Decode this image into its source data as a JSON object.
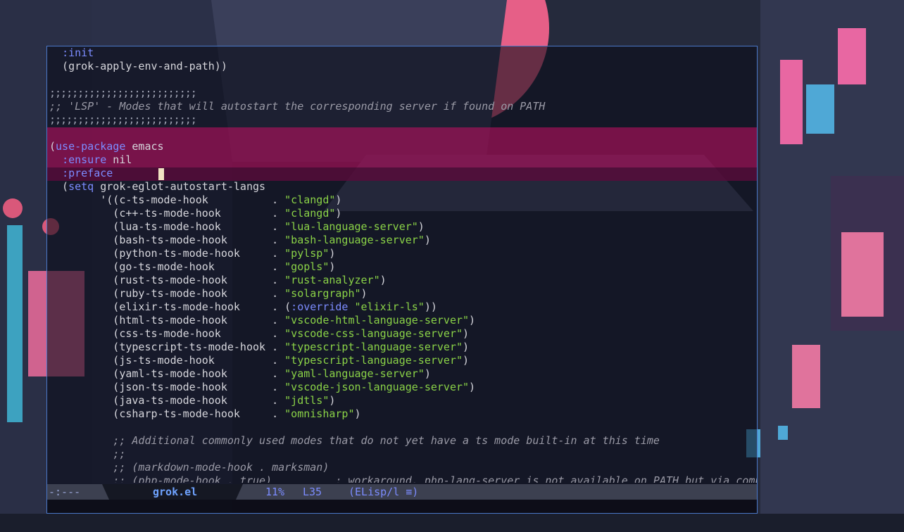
{
  "editor": {
    "lines": [
      [
        {
          "t": "  "
        },
        {
          "t": ":init",
          "c": "kw"
        }
      ],
      [
        {
          "t": "  (grok-apply-env-and-path))"
        }
      ],
      [
        {
          "t": ""
        }
      ],
      [
        {
          "t": ";;;;;;;;;;;;;;;;;;;;;;;;;;",
          "c": "cml"
        }
      ],
      [
        {
          "t": ";; ",
          "c": "cm"
        },
        {
          "t": "'LSP'",
          "c": "cm"
        },
        {
          "t": " - Modes that will autostart the corresponding server if found on PATH",
          "c": "cm"
        }
      ],
      [
        {
          "t": ";;;;;;;;;;;;;;;;;;;;;;;;;;",
          "c": "cml"
        }
      ],
      [
        {
          "t": ""
        }
      ],
      [
        {
          "t": "("
        },
        {
          "t": "use-package",
          "c": "kw"
        },
        {
          "t": " emacs"
        }
      ],
      [
        {
          "t": "  "
        },
        {
          "t": ":ensure",
          "c": "kw"
        },
        {
          "t": " nil"
        }
      ],
      [
        {
          "t": "  "
        },
        {
          "t": ":preface",
          "c": "kw"
        }
      ],
      [
        {
          "t": "  ("
        },
        {
          "t": "setq",
          "c": "kw"
        },
        {
          "t": " grok-eglot-autostart-langs"
        }
      ],
      [
        {
          "t": "        '((c-ts-mode-hook          . "
        },
        {
          "t": "\"clangd\"",
          "c": "str"
        },
        {
          "t": ")"
        }
      ],
      [
        {
          "t": "          (c++-ts-mode-hook        . "
        },
        {
          "t": "\"clangd\"",
          "c": "str"
        },
        {
          "t": ")"
        }
      ],
      [
        {
          "t": "          (lua-ts-mode-hook        . "
        },
        {
          "t": "\"lua-language-server\"",
          "c": "str"
        },
        {
          "t": ")"
        }
      ],
      [
        {
          "t": "          (bash-ts-mode-hook       . "
        },
        {
          "t": "\"bash-language-server\"",
          "c": "str"
        },
        {
          "t": ")"
        }
      ],
      [
        {
          "t": "          (python-ts-mode-hook     . "
        },
        {
          "t": "\"pylsp\"",
          "c": "str"
        },
        {
          "t": ")"
        }
      ],
      [
        {
          "t": "          (go-ts-mode-hook         . "
        },
        {
          "t": "\"gopls\"",
          "c": "str"
        },
        {
          "t": ")"
        }
      ],
      [
        {
          "t": "          (rust-ts-mode-hook       . "
        },
        {
          "t": "\"rust-analyzer\"",
          "c": "str"
        },
        {
          "t": ")"
        }
      ],
      [
        {
          "t": "          (ruby-ts-mode-hook       . "
        },
        {
          "t": "\"solargraph\"",
          "c": "str"
        },
        {
          "t": ")"
        }
      ],
      [
        {
          "t": "          (elixir-ts-mode-hook     . ("
        },
        {
          "t": ":override",
          "c": "kw"
        },
        {
          "t": " "
        },
        {
          "t": "\"elixir-ls\"",
          "c": "str"
        },
        {
          "t": "))"
        }
      ],
      [
        {
          "t": "          (html-ts-mode-hook       . "
        },
        {
          "t": "\"vscode-html-language-server\"",
          "c": "str"
        },
        {
          "t": ")"
        }
      ],
      [
        {
          "t": "          (css-ts-mode-hook        . "
        },
        {
          "t": "\"vscode-css-language-server\"",
          "c": "str"
        },
        {
          "t": ")"
        }
      ],
      [
        {
          "t": "          (typescript-ts-mode-hook . "
        },
        {
          "t": "\"typescript-language-server\"",
          "c": "str"
        },
        {
          "t": ")"
        }
      ],
      [
        {
          "t": "          (js-ts-mode-hook         . "
        },
        {
          "t": "\"typescript-language-server\"",
          "c": "str"
        },
        {
          "t": ")"
        }
      ],
      [
        {
          "t": "          (yaml-ts-mode-hook       . "
        },
        {
          "t": "\"yaml-language-server\"",
          "c": "str"
        },
        {
          "t": ")"
        }
      ],
      [
        {
          "t": "          (json-ts-mode-hook       . "
        },
        {
          "t": "\"vscode-json-language-server\"",
          "c": "str"
        },
        {
          "t": ")"
        }
      ],
      [
        {
          "t": "          (java-ts-mode-hook       . "
        },
        {
          "t": "\"jdtls\"",
          "c": "str"
        },
        {
          "t": ")"
        }
      ],
      [
        {
          "t": "          (csharp-ts-mode-hook     . "
        },
        {
          "t": "\"omnisharp\"",
          "c": "str"
        },
        {
          "t": ")"
        }
      ],
      [
        {
          "t": ""
        }
      ],
      [
        {
          "t": "          "
        },
        {
          "t": ";; Additional commonly used modes that do not yet have a ts mode built-in at this time",
          "c": "cm"
        }
      ],
      [
        {
          "t": "          "
        },
        {
          "t": ";;",
          "c": "cm"
        }
      ],
      [
        {
          "t": "          "
        },
        {
          "t": ";; (markdown-mode-hook . marksman)",
          "c": "cm"
        }
      ],
      [
        {
          "t": "          "
        },
        {
          "t": ";; (php-mode-hook . true)          ; workaround, php-lang-server is not available on PATH but via composer",
          "c": "cm"
        }
      ]
    ]
  },
  "modeline": {
    "status": "-:---",
    "filename": "grok.el",
    "percent": "11%",
    "line": "L35",
    "mode": "(ELisp/l ≡)"
  },
  "colors": {
    "keyword": "#7c8cff",
    "string": "#8ad247",
    "comment": "#9a9aa6",
    "region_highlight": "#c80e64",
    "frame_border": "#4a78c8",
    "cursor": "#f0e3c2"
  }
}
